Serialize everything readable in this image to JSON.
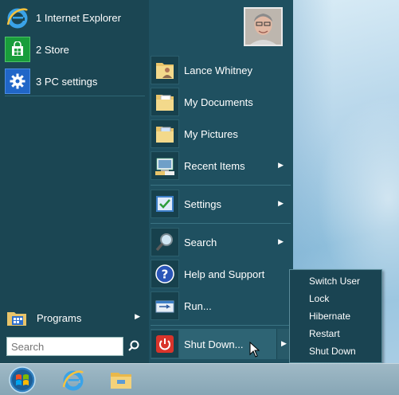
{
  "pinned": [
    {
      "label": "1 Internet Explorer",
      "icon": "internet-explorer-icon"
    },
    {
      "label": "2 Store",
      "icon": "store-icon"
    },
    {
      "label": "3 PC settings",
      "icon": "settings-gear-icon"
    }
  ],
  "programs": {
    "label": "Programs",
    "icon": "programs-folder-icon"
  },
  "search": {
    "placeholder": "Search"
  },
  "user": {
    "name": "Lance Whitney"
  },
  "right_items": {
    "lance": "Lance Whitney",
    "documents": "My Documents",
    "pictures": "My Pictures",
    "recent": "Recent Items",
    "settings": "Settings",
    "search": "Search",
    "help": "Help and Support",
    "run": "Run...",
    "shutdown": "Shut Down..."
  },
  "shutdown_menu": {
    "items": [
      "Switch User",
      "Lock",
      "Hibernate",
      "Restart",
      "Shut Down"
    ]
  },
  "colors": {
    "menu_bg": "#1d4c5a",
    "store_tile": "#199d3b",
    "settings_tile": "#2066c8",
    "shutdown_red": "#d9342b"
  }
}
